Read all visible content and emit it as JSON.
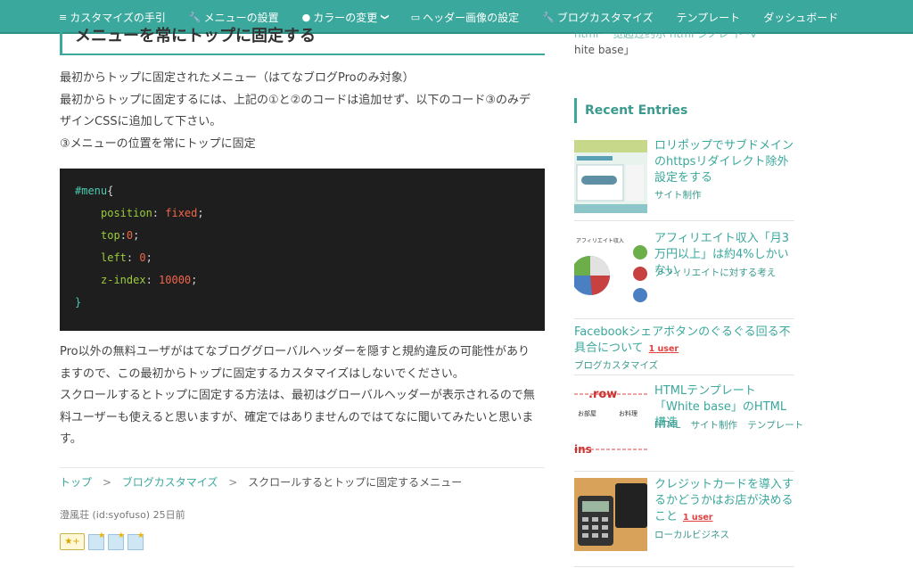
{
  "nav": {
    "items": [
      {
        "icon": "list-icon",
        "glyph": "≡",
        "label": "カスタマイズの手引"
      },
      {
        "icon": "wrench-icon",
        "glyph": "🔧",
        "label": "メニューの設置"
      },
      {
        "icon": "palette-icon",
        "glyph": "●",
        "label": "カラーの変更"
      },
      {
        "icon": "image-icon",
        "glyph": "▭",
        "label": "ヘッダー画像の設定"
      },
      {
        "icon": "wrench-icon",
        "glyph": "🔧",
        "label": "ブログカスタマイズ"
      },
      {
        "icon": "",
        "glyph": "",
        "label": "テンプレート"
      },
      {
        "icon": "",
        "glyph": "",
        "label": "ダッシュボード"
      }
    ],
    "dropdown_glyph": "❯"
  },
  "article": {
    "heading": "メニューを常にトップに固定する",
    "para1": [
      "最初からトップに固定されたメニュー（はてなブログProのみ対象）",
      "最初からトップに固定するには、上記の①と②のコードは追加せず、以下のコード③のみデ",
      "ザインCSSに追加して下さい。",
      "③メニューの位置を常にトップに固定"
    ],
    "code": {
      "selector": "#menu",
      "open": "{",
      "close": "}",
      "lines": [
        {
          "prop": "position",
          "value": "fixed"
        },
        {
          "prop": "top",
          "value": "0"
        },
        {
          "prop": "left",
          "value": "0"
        },
        {
          "prop": "z-index",
          "value": "10000"
        }
      ]
    },
    "para2": [
      "Pro以外の無料ユーザがはてなブロググローバルヘッダーを隠すと規約違反の可能性があり",
      "ますので、この最初からトップに固定するカスタマイズはしないでください。",
      "スクロールするとトップに固定する方法は、最初はグローバルヘッダーが表示されるので無",
      "料ユーザーも使えると思いますが、確定ではありませんのではてなに聞いてみたいと思いま",
      "す。"
    ],
    "breadcrumb": {
      "home": "トップ",
      "sep": ">",
      "category": "ブログカスタマイズ",
      "current": "スクロールするとトップに固定するメニュー"
    },
    "author": "澄風荘 (id:syofuso) 25日前",
    "star_add_label": "★+",
    "star_count": 3
  },
  "sidebar": {
    "top_line1": "html  一览超过约示   html  ンノレ   ト   ·V",
    "top_line2": "hite base」",
    "recent_title": "Recent Entries",
    "entries": [
      {
        "title": "ロリポップでサブドメインのhttpsリダイレクト除外設定をする",
        "categories": [
          "サイト制作"
        ],
        "users": ""
      },
      {
        "title": "アフィリエイト収入「月3万円以上」は約4%しかいない",
        "categories": [
          "アフィリエイトに対する考え"
        ],
        "users": ""
      },
      {
        "title": "Facebookシェアボタンのぐるぐる回る不具合について",
        "categories": [
          "ブログカスタマイズ"
        ],
        "users": "1 user"
      },
      {
        "title": "HTMLテンプレート「White base」のHTML構造",
        "categories": [
          "HTML",
          "サイト制作",
          "テンプレート"
        ],
        "users": ""
      },
      {
        "title": "クレジットカードを導入するかどうかはお店が決めること",
        "categories": [
          "ローカルビジネス"
        ],
        "users": "1 user"
      }
    ],
    "thumb4_text": ".row",
    "thumb4_text2": "ins"
  },
  "colors": {
    "accent": "#3aa89c",
    "nav_bg": "#3aa89c",
    "code_bg": "#1e1e1e",
    "code_selector": "#4ec9b0",
    "code_property": "#9ccc3c",
    "code_value": "#f2664a",
    "users_badge": "#e04040"
  }
}
